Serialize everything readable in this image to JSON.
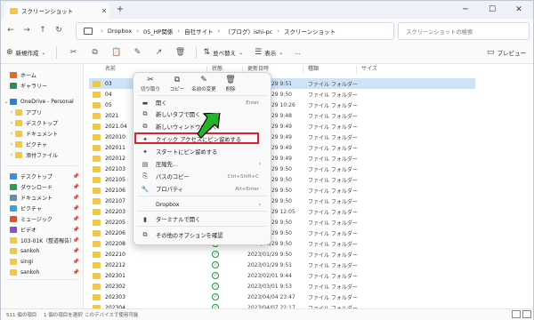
{
  "window": {
    "tab_title": "スクリーンショット",
    "tab_close": "✕",
    "new_tab": "+",
    "controls": [
      "─",
      "☐",
      "✕"
    ]
  },
  "address": {
    "breadcrumbs": [
      "Dropbox",
      "05_HP関係",
      "自社サイト",
      "（ブログ）ishi-pc",
      "スクリーンショット"
    ],
    "separator": "›",
    "search_placeholder": "スクリーンショットの検索"
  },
  "toolbar": {
    "new_label": "新規作成",
    "sort_label": "並べ替え",
    "view_label": "表示",
    "more": "…",
    "preview_label": "プレビュー"
  },
  "sidebar": {
    "items": [
      {
        "label": "ホーム",
        "color": "#e06a2c",
        "chev": "",
        "pinned": false
      },
      {
        "label": "ギャラリー",
        "color": "#2f8a5e",
        "chev": "",
        "pinned": false
      },
      {
        "label": "OneDrive - Personal",
        "color": "#2d7fd3",
        "chev": "⌄",
        "pinned": false
      },
      {
        "label": "アプリ",
        "color": "#f2c744",
        "chev": "›",
        "pinned": false
      },
      {
        "label": "デスクトップ",
        "color": "#f2c744",
        "chev": "›",
        "pinned": false
      },
      {
        "label": "ドキュメント",
        "color": "#f2c744",
        "chev": "›",
        "pinned": false
      },
      {
        "label": "ピクチャ",
        "color": "#f2c744",
        "chev": "›",
        "pinned": false
      },
      {
        "label": "添付ファイル",
        "color": "#f2c744",
        "chev": "›",
        "pinned": false
      },
      {
        "label": "デスクトップ",
        "color": "#3e8ee0",
        "chev": "",
        "pinned": true
      },
      {
        "label": "ダウンロード",
        "color": "#2d9a55",
        "chev": "",
        "pinned": true
      },
      {
        "label": "ドキュメント",
        "color": "#6f8aa8",
        "chev": "",
        "pinned": true
      },
      {
        "label": "ピクチャ",
        "color": "#3ea0d8",
        "chev": "",
        "pinned": true
      },
      {
        "label": "ミュージック",
        "color": "#e0522c",
        "chev": "",
        "pinned": true
      },
      {
        "label": "ビデオ",
        "color": "#8a4fc9",
        "chev": "",
        "pinned": true
      },
      {
        "label": "103-01K（整道報告）",
        "color": "#f2c744",
        "chev": "",
        "pinned": true
      },
      {
        "label": "sankoh",
        "color": "#f2c744",
        "chev": "",
        "pinned": true
      },
      {
        "label": "singi",
        "color": "#f2c744",
        "chev": "",
        "pinned": true
      },
      {
        "label": "sankoh",
        "color": "#f2c744",
        "chev": "",
        "pinned": true
      }
    ]
  },
  "columns": {
    "name": "名前",
    "status": "状態",
    "modified": "更新日時",
    "type": "種類",
    "size": "サイズ"
  },
  "files": [
    {
      "name": "03",
      "date": "2023/01/29 9:51",
      "type": "ファイル フォルダー",
      "selected": true
    },
    {
      "name": "04",
      "date": "2023/01/29 9:50",
      "type": "ファイル フォルダー",
      "selected": false
    },
    {
      "name": "05",
      "date": "2023/01/29 10:26",
      "type": "ファイル フォルダー",
      "selected": false
    },
    {
      "name": "2021",
      "date": "2023/01/29 9:48",
      "type": "ファイル フォルダー",
      "selected": false
    },
    {
      "name": "2021.04",
      "date": "2023/01/29 9:49",
      "type": "ファイル フォルダー",
      "selected": false
    },
    {
      "name": "202010",
      "date": "2023/01/29 9:49",
      "type": "ファイル フォルダー",
      "selected": false
    },
    {
      "name": "202011",
      "date": "2023/01/29 9:49",
      "type": "ファイル フォルダー",
      "selected": false
    },
    {
      "name": "202012",
      "date": "2023/01/29 9:49",
      "type": "ファイル フォルダー",
      "selected": false
    },
    {
      "name": "202103",
      "date": "2023/01/29 9:50",
      "type": "ファイル フォルダー",
      "selected": false
    },
    {
      "name": "202105",
      "date": "2023/01/29 9:50",
      "type": "ファイル フォルダー",
      "selected": false
    },
    {
      "name": "202106",
      "date": "2023/01/29 9:50",
      "type": "ファイル フォルダー",
      "selected": false
    },
    {
      "name": "202107",
      "date": "2023/01/29 9:50",
      "type": "ファイル フォルダー",
      "selected": false
    },
    {
      "name": "202203",
      "date": "2023/01/29 12:05",
      "type": "ファイル フォルダー",
      "selected": false
    },
    {
      "name": "202205",
      "date": "2023/01/29 9:50",
      "type": "ファイル フォルダー",
      "selected": false
    },
    {
      "name": "202206",
      "date": "2023/01/29 9:50",
      "type": "ファイル フォルダー",
      "selected": false
    },
    {
      "name": "202208",
      "date": "2023/01/29 9:50",
      "type": "ファイル フォルダー",
      "selected": false
    },
    {
      "name": "202210",
      "date": "2023/01/29 9:50",
      "type": "ファイル フォルダー",
      "selected": false
    },
    {
      "name": "202212",
      "date": "2023/01/29 9:51",
      "type": "ファイル フォルダー",
      "selected": false
    },
    {
      "name": "202301",
      "date": "2023/02/01 9:44",
      "type": "ファイル フォルダー",
      "selected": false
    },
    {
      "name": "202302",
      "date": "2023/03/01 9:53",
      "type": "ファイル フォルダー",
      "selected": false
    },
    {
      "name": "202303",
      "date": "2023/04/04 23:47",
      "type": "ファイル フォルダー",
      "selected": false
    },
    {
      "name": "202304",
      "date": "2023/04/07 22:17",
      "type": "ファイル フォルダー",
      "selected": false
    }
  ],
  "context_menu": {
    "quick_actions": [
      {
        "label": "切り取り",
        "glyph": "✂"
      },
      {
        "label": "コピー",
        "glyph": "⧉"
      },
      {
        "label": "名前の変更",
        "glyph": "✎"
      },
      {
        "label": "削除",
        "glyph": "🗑"
      }
    ],
    "items": [
      {
        "label": "開く",
        "shortcut": "Enter",
        "glyph": "▬",
        "arrow": ""
      },
      {
        "label": "新しいタブで開く",
        "shortcut": "",
        "glyph": "⧉",
        "arrow": ""
      },
      {
        "label": "新しいウィンドウで開く",
        "shortcut": "",
        "glyph": "⧉",
        "arrow": ""
      },
      {
        "label": "クイック アクセスにピン留めする",
        "shortcut": "",
        "glyph": "✦",
        "arrow": ""
      },
      {
        "label": "スタートにピン留めする",
        "shortcut": "",
        "glyph": "✦",
        "arrow": ""
      },
      {
        "label": "圧縮先...",
        "shortcut": "",
        "glyph": "▤",
        "arrow": "›"
      },
      {
        "label": "パスのコピー",
        "shortcut": "Ctrl+Shift+C",
        "glyph": "⎘",
        "arrow": ""
      },
      {
        "label": "プロパティ",
        "shortcut": "Alt+Enter",
        "glyph": "🔧",
        "arrow": ""
      },
      {
        "label": "Dropbox",
        "shortcut": "",
        "glyph": "",
        "arrow": "›"
      },
      {
        "label": "ターミナルで開く",
        "shortcut": "",
        "glyph": "▮",
        "arrow": ""
      },
      {
        "label": "その他のオプションを確認",
        "shortcut": "",
        "glyph": "⧉",
        "arrow": ""
      }
    ]
  },
  "statusbar": {
    "count": "511 個の項目",
    "selected": "1 個の項目を選択",
    "available": "このデバイスで使用可能"
  }
}
